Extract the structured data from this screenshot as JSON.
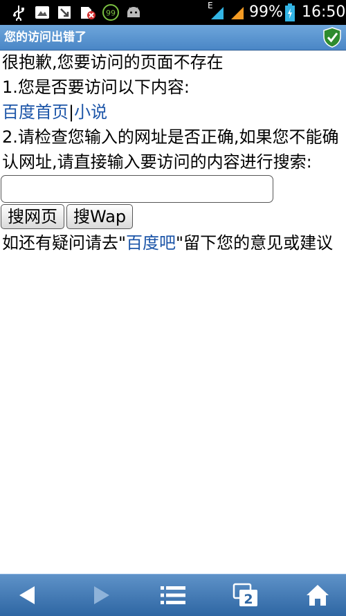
{
  "status_bar": {
    "network_type": "E",
    "battery_percent": "99%",
    "time": "16:50",
    "notification_badge": "99",
    "icons": [
      "usb-icon",
      "gallery-icon",
      "download-icon",
      "no-sim-icon",
      "battery-saver-icon",
      "android-icon",
      "signal-icon",
      "battery-icon"
    ]
  },
  "title_bar": {
    "title": "您的访问出错了",
    "icon": "security-shield-icon"
  },
  "content": {
    "apology": "很抱歉,您要访问的页面不存在",
    "step1": "1.您是否要访问以下内容:",
    "links": {
      "baidu_home": "百度首页",
      "separator": "|",
      "novel": "小说"
    },
    "step2": "2.请检查您输入的网址是否正确,如果您不能确认网址,请直接输入要访问的内容进行搜索:",
    "search": {
      "value": "",
      "placeholder": ""
    },
    "buttons": {
      "search_web": "搜网页",
      "search_wap": "搜Wap"
    },
    "feedback": {
      "prefix": "如还有疑问请去\"",
      "link": "百度吧",
      "suffix": "\"留下您的意见或建议"
    }
  },
  "bottom_bar": {
    "tab_count": "2",
    "icons": [
      "back-icon",
      "forward-icon",
      "menu-icon",
      "tabs-icon",
      "home-icon"
    ]
  },
  "colors": {
    "link": "#1c55a8",
    "title_bar": "#5a95d1",
    "bottom_bar": "#3d74b0",
    "status_accent": "#33b5e5"
  }
}
